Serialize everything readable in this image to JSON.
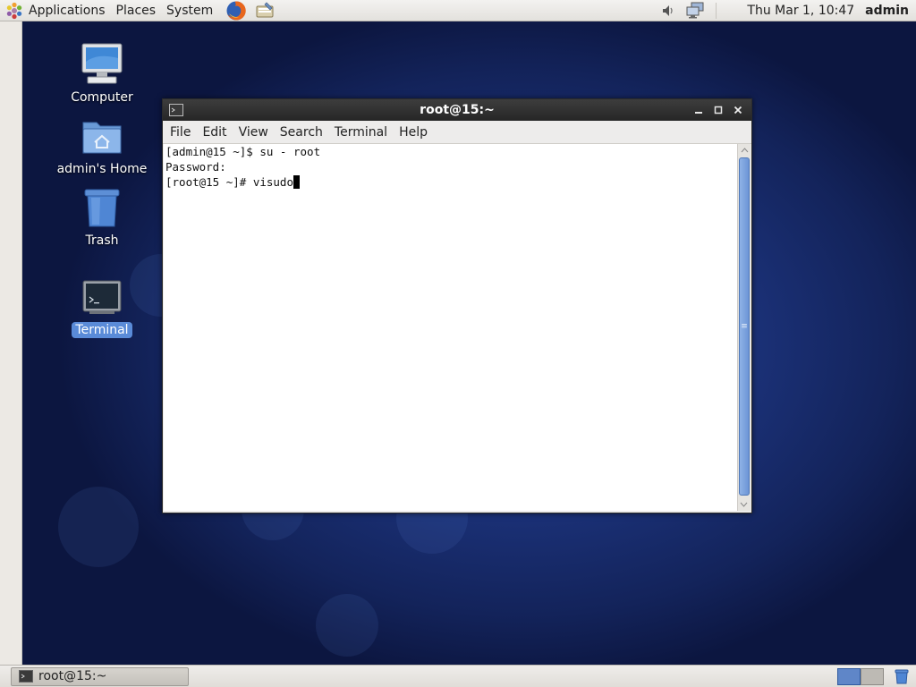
{
  "top_panel": {
    "menus": [
      {
        "label": "Applications",
        "icon": "gnome-foot-icon"
      },
      {
        "label": "Places"
      },
      {
        "label": "System"
      }
    ],
    "launchers": [
      "firefox-icon",
      "text-editor-icon"
    ],
    "tray": [
      "volume-icon",
      "network-icon"
    ],
    "clock": "Thu Mar  1, 10:47",
    "user": "admin"
  },
  "desktop": {
    "icons": [
      {
        "label": "Computer",
        "icon": "computer-icon",
        "selected": false
      },
      {
        "label": "admin's Home",
        "icon": "home-folder-icon",
        "selected": false
      },
      {
        "label": "Trash",
        "icon": "trash-icon",
        "selected": false
      },
      {
        "label": "Terminal",
        "icon": "terminal-icon",
        "selected": true
      }
    ]
  },
  "terminal": {
    "title": "root@15:~",
    "menu": [
      "File",
      "Edit",
      "View",
      "Search",
      "Terminal",
      "Help"
    ],
    "lines": [
      "[admin@15 ~]$ su - root",
      "Password:",
      "[root@15 ~]# visudo"
    ],
    "controls": {
      "minimize": "_",
      "maximize": "□",
      "close": "×"
    }
  },
  "bottom_panel": {
    "task": {
      "label": "root@15:~",
      "icon": "terminal-icon"
    },
    "workspaces": [
      {
        "active": true
      },
      {
        "active": false
      }
    ],
    "applet": "trash-icon"
  },
  "colors": {
    "desktop_bg": "#1d3580",
    "title_bar": "#2f2f2f",
    "selection": "#5a8bd8",
    "scroll_thumb": "#7aa0dc"
  }
}
